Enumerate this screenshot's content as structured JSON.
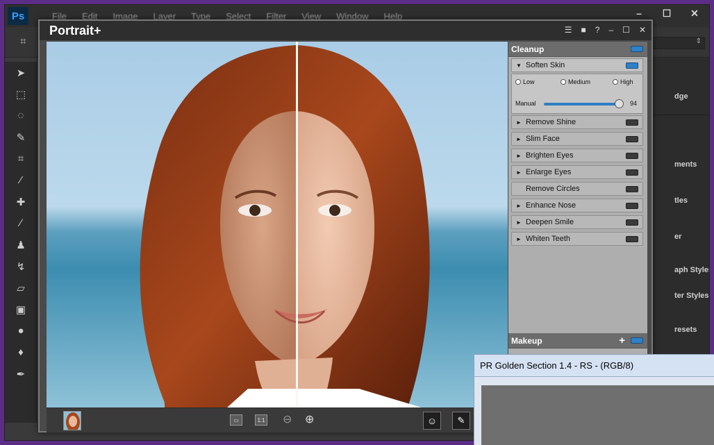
{
  "photoshop": {
    "logo": "Ps",
    "menu": [
      "File",
      "Edit",
      "Image",
      "Layer",
      "Type",
      "Select",
      "Filter",
      "View",
      "Window",
      "Help"
    ],
    "window_controls": [
      "–",
      "☐",
      "✕"
    ],
    "right_panel_items": [
      "dge",
      "ments",
      "tles",
      "er",
      "aph Styles",
      "ter Styles",
      "resets"
    ]
  },
  "plugin": {
    "title": "Portrait+",
    "title_controls": [
      "☰",
      "■",
      "?",
      "–",
      "☐",
      "✕"
    ],
    "cleanup": {
      "title": "Cleanup",
      "soften_skin": {
        "label": "Soften Skin",
        "options": [
          "Low",
          "Medium",
          "High"
        ],
        "slider_label": "Manual",
        "slider_value": "94"
      },
      "items": [
        "Remove Shine",
        "Slim Face",
        "Brighten Eyes",
        "Enlarge Eyes",
        "Remove Circles",
        "Enhance Nose",
        "Deepen Smile",
        "Whiten Teeth"
      ]
    },
    "makeup": {
      "title": "Makeup"
    },
    "bottom": {
      "view_btn_1": "▭",
      "view_btn_2": "1:1"
    }
  },
  "secondary_window": {
    "title": "PR Golden Section 1.4 - RS - (RGB/8)"
  },
  "colors": {
    "background": "#5c2d86",
    "accent": "#2e80c8"
  }
}
